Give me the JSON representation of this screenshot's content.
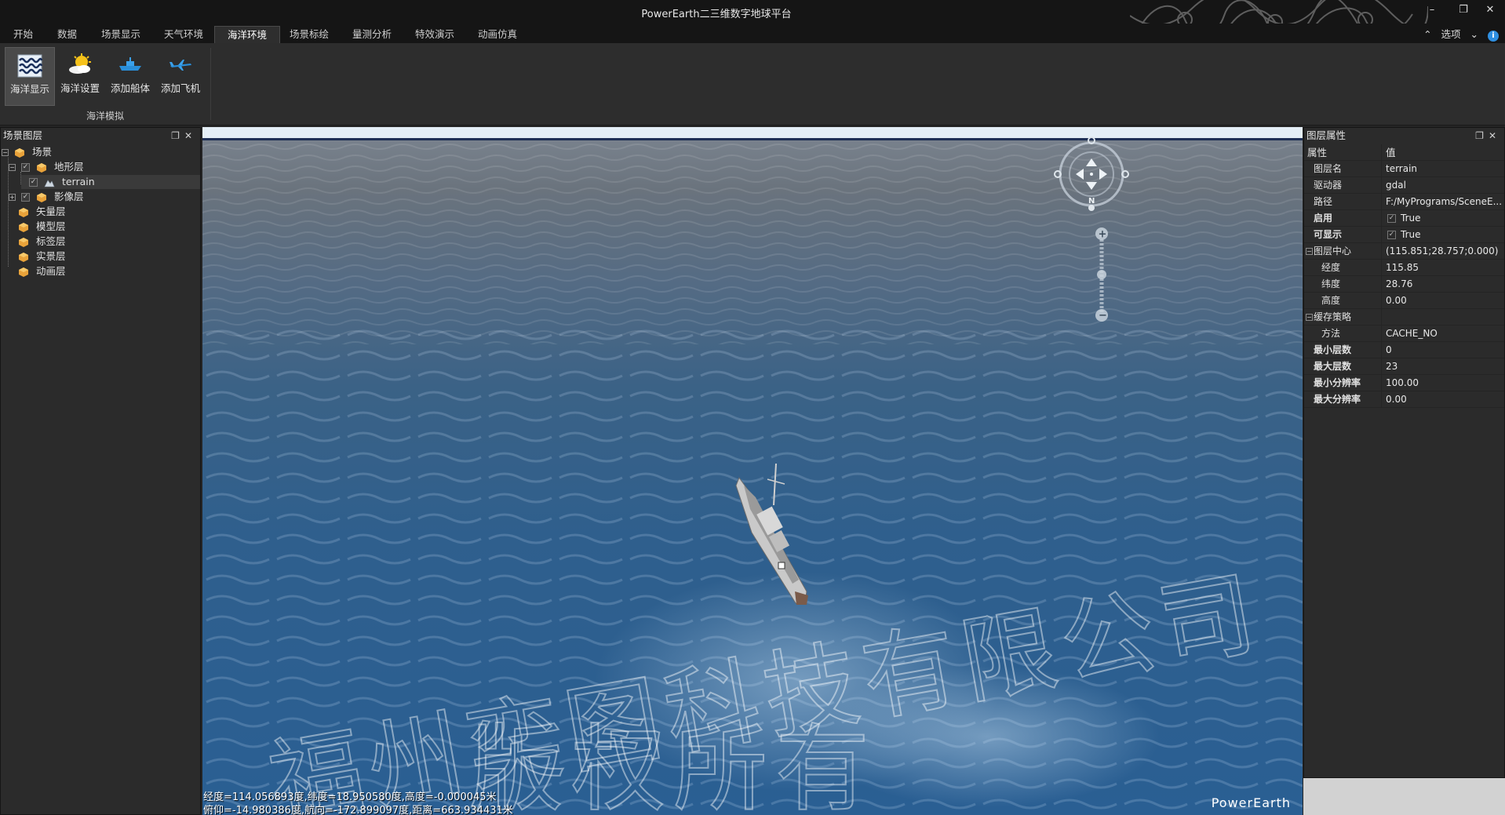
{
  "window": {
    "title": "PowerEarth二三维数字地球平台"
  },
  "menu": {
    "tabs": [
      "开始",
      "数据",
      "场景显示",
      "天气环境",
      "海洋环境",
      "场景标绘",
      "量测分析",
      "特效演示",
      "动画仿真"
    ],
    "active_index": 4,
    "options_label": "选项"
  },
  "ribbon": {
    "buttons": [
      {
        "label": "海洋显示",
        "icon": "waves-icon",
        "active": true
      },
      {
        "label": "海洋设置",
        "icon": "sun-cloud-icon",
        "active": false
      },
      {
        "label": "添加船体",
        "icon": "ship-icon",
        "active": false
      },
      {
        "label": "添加飞机",
        "icon": "airplane-icon",
        "active": false
      }
    ],
    "group_label": "海洋模拟"
  },
  "layer_panel": {
    "title": "场景图层",
    "tree": {
      "root": "场景",
      "terrain_group": "地形层",
      "terrain_item": "terrain",
      "imagery_group": "影像层",
      "others": [
        "矢量层",
        "模型层",
        "标签层",
        "实景层",
        "动画层"
      ]
    }
  },
  "viewport": {
    "status_line1": "经度=114.056893度,纬度=18.950580度,高度=-0.000045米",
    "status_line2": "俯仰=-14.980386度,航向=-172.899097度,距离=663.934431米",
    "brand": "PowerEarth",
    "watermark_line1": "福州奕图科技有限公司",
    "watermark_line2": "版权所有"
  },
  "properties_panel": {
    "title": "图层属性",
    "col_key": "属性",
    "col_value": "值",
    "layer_name": {
      "key": "图层名",
      "value": "terrain"
    },
    "driver": {
      "key": "驱动器",
      "value": "gdal"
    },
    "path": {
      "key": "路径",
      "value": "F:/MyPrograms/SceneE..."
    },
    "enabled": {
      "key": "启用",
      "value": "True"
    },
    "visible": {
      "key": "可显示",
      "value": "True"
    },
    "center": {
      "key": "图层中心",
      "value": "(115.851;28.757;0.000)"
    },
    "longitude": {
      "key": "经度",
      "value": "115.85"
    },
    "latitude": {
      "key": "纬度",
      "value": "28.76"
    },
    "height": {
      "key": "高度",
      "value": "0.00"
    },
    "cache_policy": {
      "key": "缓存策略"
    },
    "method": {
      "key": "方法",
      "value": "CACHE_NO"
    },
    "min_level": {
      "key": "最小层数",
      "value": "0"
    },
    "max_level": {
      "key": "最大层数",
      "value": "23"
    },
    "min_resolution": {
      "key": "最小分辨率",
      "value": "100.00"
    },
    "max_resolution": {
      "key": "最大分辨率",
      "value": "0.00"
    }
  },
  "colors": {
    "title_bar": "#151515",
    "ribbon": "#2d2d2d",
    "panel": "#2b2b2b",
    "sea_deep": "#2a5f93",
    "info_blue": "#2f8fe0"
  }
}
